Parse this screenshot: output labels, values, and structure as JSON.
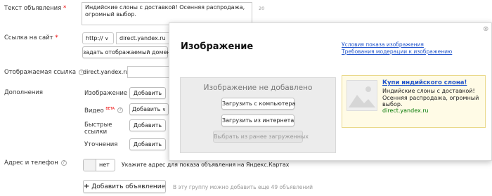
{
  "form": {
    "ad_text_label": "Текст объявления",
    "ad_text_value": "Индийские слоны с доставкой! Осенняя распродажа, огромный выбор.",
    "ad_text_counter": "20",
    "site_link_label": "Ссылка на сайт",
    "protocol_value": "http://",
    "site_url_value": "direct.yandex.ru",
    "display_domain_button": "задать отображаемый домен",
    "display_link_label": "Отображаемая ссылка",
    "display_link_value": "direct.yandex.ru/",
    "additions_label": "Дополнения",
    "image_label": "Изображение",
    "image_add_button": "Добавить",
    "video_label": "Видео",
    "video_beta": "BETA",
    "video_add_button": "Добавить",
    "quick_links_label": "Быстрые ссылки",
    "quick_links_add_button": "Добавить",
    "clarifications_label": "Уточнения",
    "clarifications_add_button": "Добавить",
    "address_phone_label": "Адрес и телефон",
    "toggle_value": "нет",
    "address_hint": "Укажите адрес для показа объявления на Яндекс.Картах",
    "add_ad_button": "Добавить объявление",
    "add_ad_hint": "В эту группу можно добавить еще 49 объявлений",
    "required_mark": "*",
    "help_mark": "?"
  },
  "popup": {
    "title": "Изображение",
    "link_conditions": "Условия показа изображения",
    "link_requirements": "Требования модерации к изображению",
    "no_image_text": "Изображение не добавлено",
    "upload_computer_button": "Загрузить с компьютера",
    "upload_internet_button": "Загрузить из интернета",
    "choose_previous_button": "Выбрать из ранее загруженных",
    "close_icon": "⊗",
    "preview": {
      "title": "Купи индийского слона!",
      "text": "Индийские слоны с доставкой! Осенняя распродажа, огромный выбор.",
      "url": "direct.yandex.ru"
    }
  },
  "colors": {
    "link": "#2255cc",
    "preview_bg": "#fffbe6",
    "required": "#e00000",
    "preview_url": "#007700"
  }
}
